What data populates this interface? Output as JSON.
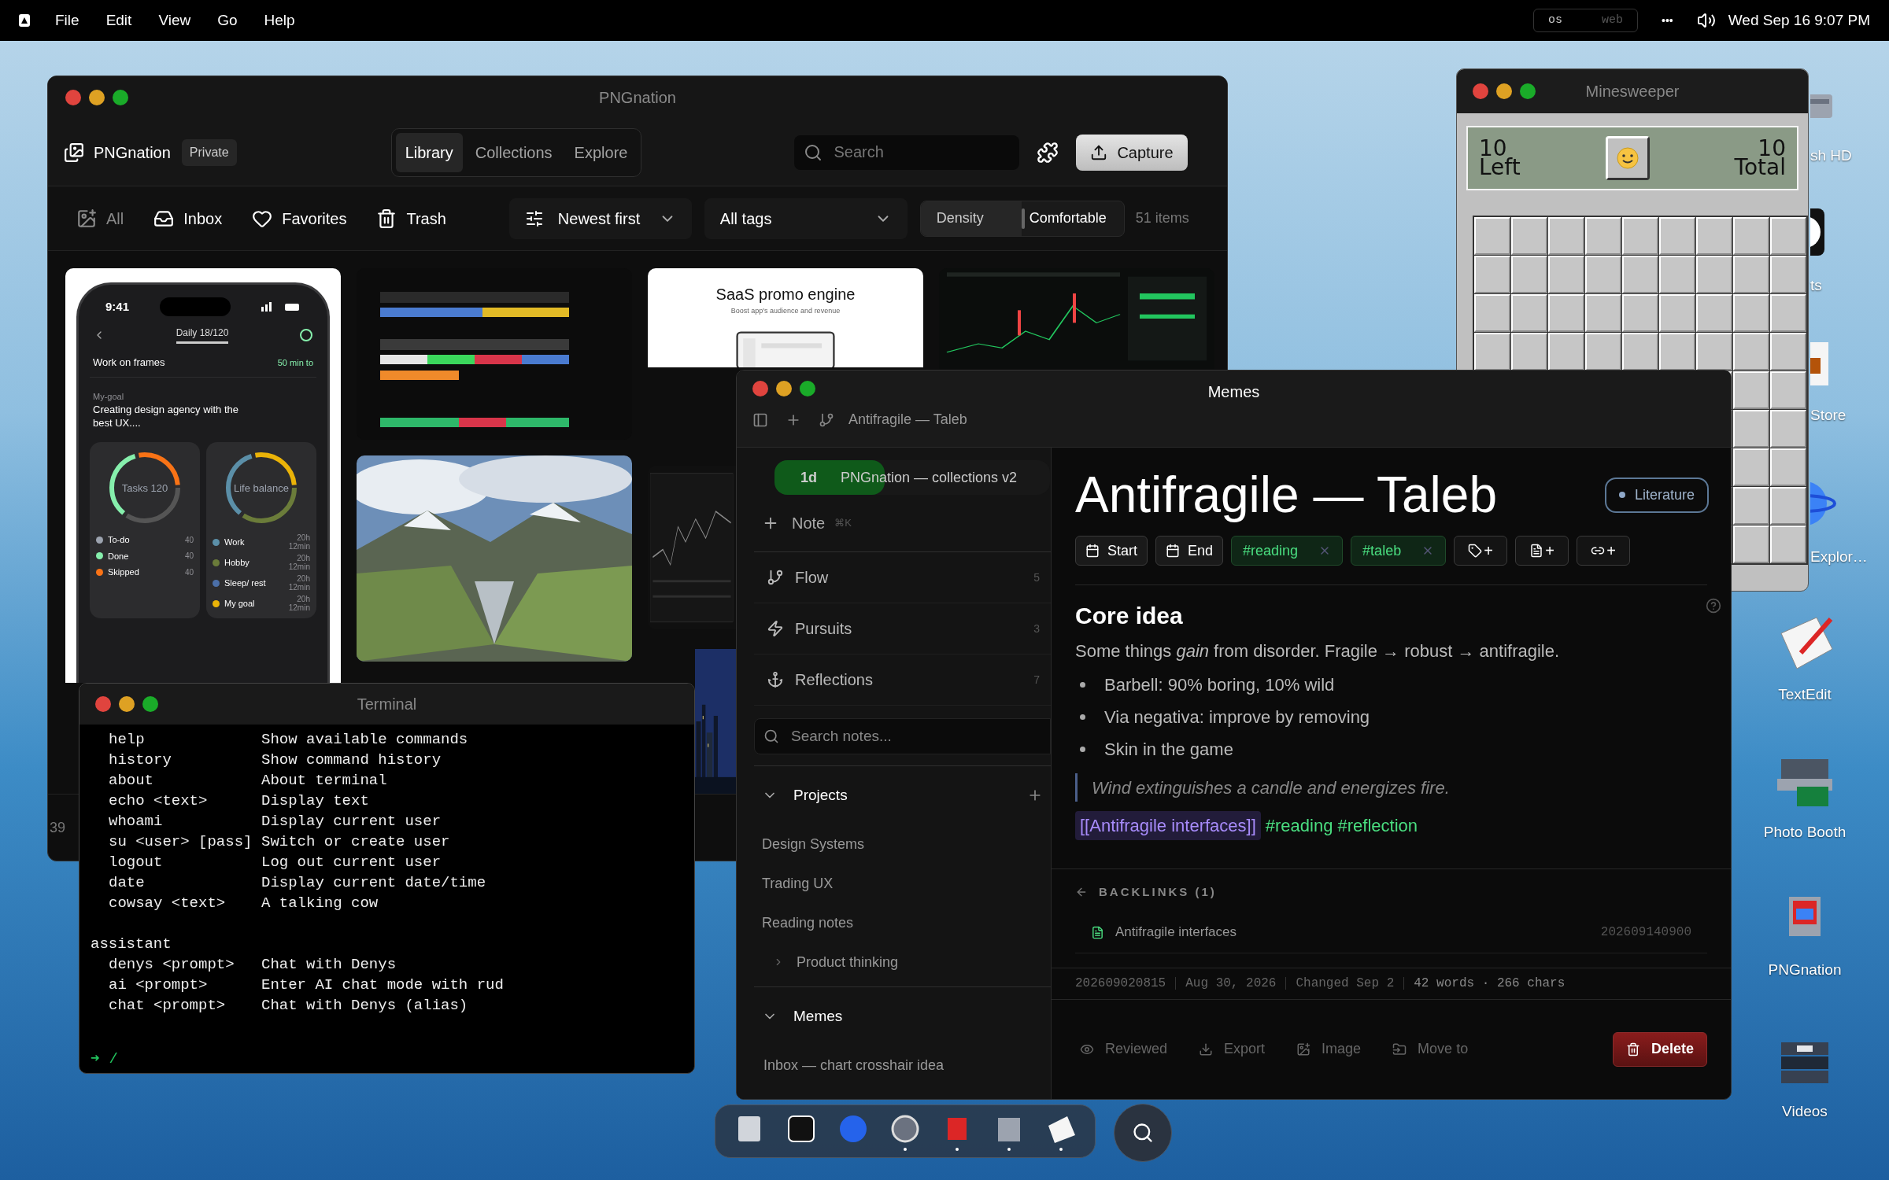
{
  "menu_bar": {
    "menus": [
      "File",
      "Edit",
      "View",
      "Go",
      "Help"
    ],
    "mode_toggle": [
      {
        "label": "os",
        "selected": true
      },
      {
        "label": "web",
        "selected": false
      }
    ],
    "more": "•••",
    "clock": "Wed Sep 16 9:07 PM"
  },
  "pngnation": {
    "title": "PNGnation",
    "app_name": "PNGnation",
    "visibility": "Private",
    "tabs": [
      {
        "label": "Library",
        "selected": true
      },
      {
        "label": "Collections",
        "selected": false
      },
      {
        "label": "Explore",
        "selected": false
      }
    ],
    "search": {
      "placeholder": "Search"
    },
    "capture": "Capture",
    "filters": [
      {
        "label": "All",
        "dimmed": true
      },
      {
        "label": "Inbox",
        "dimmed": false
      },
      {
        "label": "Favorites",
        "dimmed": false
      },
      {
        "label": "Trash",
        "dimmed": false
      }
    ],
    "sort": "Newest first",
    "tags": "All tags",
    "density": {
      "label": "Density",
      "value": "Comfortable"
    },
    "count": "51 items",
    "phone": {
      "time": "9:41",
      "counter": "Daily 18/120",
      "task": "Work on frames",
      "task_time": "50 min to",
      "goal_label": "My-goal",
      "goal": "Creating design agency with the best UX....",
      "rings": [
        {
          "label": "Tasks 120"
        },
        {
          "label": "Life balance"
        }
      ],
      "legend_left": [
        {
          "label": "To-do",
          "value": "40",
          "color": "#9ca3af"
        },
        {
          "label": "Done",
          "value": "40",
          "color": "#86efac"
        },
        {
          "label": "Skipped",
          "value": "40",
          "color": "#f97316"
        }
      ],
      "legend_right": [
        {
          "label": "Work",
          "value": "20h 12min",
          "color": "#5b8fa8"
        },
        {
          "label": "Hobby",
          "value": "20h 12min",
          "color": "#6b7c3a"
        },
        {
          "label": "Sleep/ rest",
          "value": "20h 12min",
          "color": "#4b6fa8"
        },
        {
          "label": "My goal",
          "value": "20h 12min",
          "color": "#eab308"
        }
      ]
    },
    "promo": {
      "title": "SaaS promo engine",
      "subtitle": "Boost app's audience and revenue"
    },
    "footer_count": "39"
  },
  "minesweeper": {
    "title": "Minesweeper",
    "left_value": "10",
    "left_label": "Left",
    "total_value": "10",
    "total_label": "Total"
  },
  "terminal": {
    "title": "Terminal",
    "commands": [
      {
        "command": "help",
        "description": "Show available commands"
      },
      {
        "command": "history",
        "description": "Show command history"
      },
      {
        "command": "about",
        "description": "About terminal"
      },
      {
        "command": "echo <text>",
        "description": "Display text"
      },
      {
        "command": "whoami",
        "description": "Display current user"
      },
      {
        "command": "su <user> [pass]",
        "description": "Switch or create user"
      },
      {
        "command": "logout",
        "description": "Log out current user"
      },
      {
        "command": "date",
        "description": "Display current date/time"
      },
      {
        "command": "cowsay <text>",
        "description": "A talking cow"
      }
    ],
    "section": "assistant",
    "assistant_commands": [
      {
        "command": "denys <prompt>",
        "description": "Chat with Denys"
      },
      {
        "command": "ai <prompt>",
        "description": "Enter AI chat mode with rud"
      },
      {
        "command": "chat <prompt>",
        "description": "Chat with Denys (alias)"
      }
    ],
    "prompt_symbol": "➜",
    "cwd": "/"
  },
  "memes": {
    "title": "Memes",
    "breadcrumb": "Antifragile — Taleb",
    "timer": {
      "badge": "1d",
      "label": "PNGnation — collections v2",
      "level": 0.4
    },
    "new_note": {
      "label": "Note",
      "shortcut": "⌘K"
    },
    "nav": [
      {
        "label": "Flow",
        "count": "5"
      },
      {
        "label": "Pursuits",
        "count": "3"
      },
      {
        "label": "Reflections",
        "count": "7"
      }
    ],
    "search": {
      "placeholder": "Search notes..."
    },
    "sections": [
      {
        "label": "Projects",
        "expanded": true,
        "addable": true,
        "items": [
          {
            "label": "Design Systems"
          },
          {
            "label": "Trading UX"
          },
          {
            "label": "Reading notes"
          },
          {
            "label": "Product thinking",
            "expanded": false
          }
        ]
      },
      {
        "label": "Memes",
        "expanded": true,
        "addable": false,
        "items": [
          {
            "label": "Inbox — chart crosshair idea"
          }
        ]
      }
    ],
    "note": {
      "title": "Antifragile — Taleb",
      "category": "Literature",
      "chips": [
        {
          "kind": "date",
          "label": "Start"
        },
        {
          "kind": "date",
          "label": "End"
        },
        {
          "kind": "tag",
          "label": "#reading"
        },
        {
          "kind": "tag",
          "label": "#taleb"
        },
        {
          "kind": "add_tag",
          "label": "+"
        },
        {
          "kind": "add_note",
          "label": "+"
        },
        {
          "kind": "add_link",
          "label": "+"
        }
      ],
      "heading": "Core idea",
      "paragraph": "Some things *gain* from disorder. Fragile → robust → antifragile.",
      "bullets": [
        "Barbell: 90% boring, 10% wild",
        "Via negativa: improve by removing",
        "Skin in the game"
      ],
      "quote": "Wind extinguishes a candle and energizes fire.",
      "wikilink": "[[Antifragile interfaces]]",
      "hashtags": "#reading #reflection",
      "backlinks_title": "BACKLINKS (1)",
      "backlinks": [
        {
          "title": "Antifragile interfaces",
          "id": "202609140900"
        }
      ],
      "meta": [
        "202609020815",
        "Aug 30, 2026",
        "Changed Sep 2",
        "42 words · 266 chars"
      ],
      "actions": [
        "Reviewed",
        "Export",
        "Image",
        "Move to"
      ],
      "delete": "Delete"
    }
  },
  "desktop_icons": [
    {
      "label": "sh HD",
      "covered": true
    },
    {
      "label": "ts",
      "covered": true
    },
    {
      "label": "Store",
      "covered": true
    },
    {
      "label": "Explor…",
      "covered": true
    },
    {
      "label": "TextEdit",
      "covered": false
    },
    {
      "label": "Photo Booth",
      "covered": false
    },
    {
      "label": "PNGnation",
      "covered": false
    },
    {
      "label": "Videos",
      "covered": false
    }
  ],
  "dock": [
    {
      "running": false
    },
    {
      "running": false
    },
    {
      "running": false
    },
    {
      "running": true
    },
    {
      "running": true
    },
    {
      "running": true
    },
    {
      "running": true
    }
  ]
}
